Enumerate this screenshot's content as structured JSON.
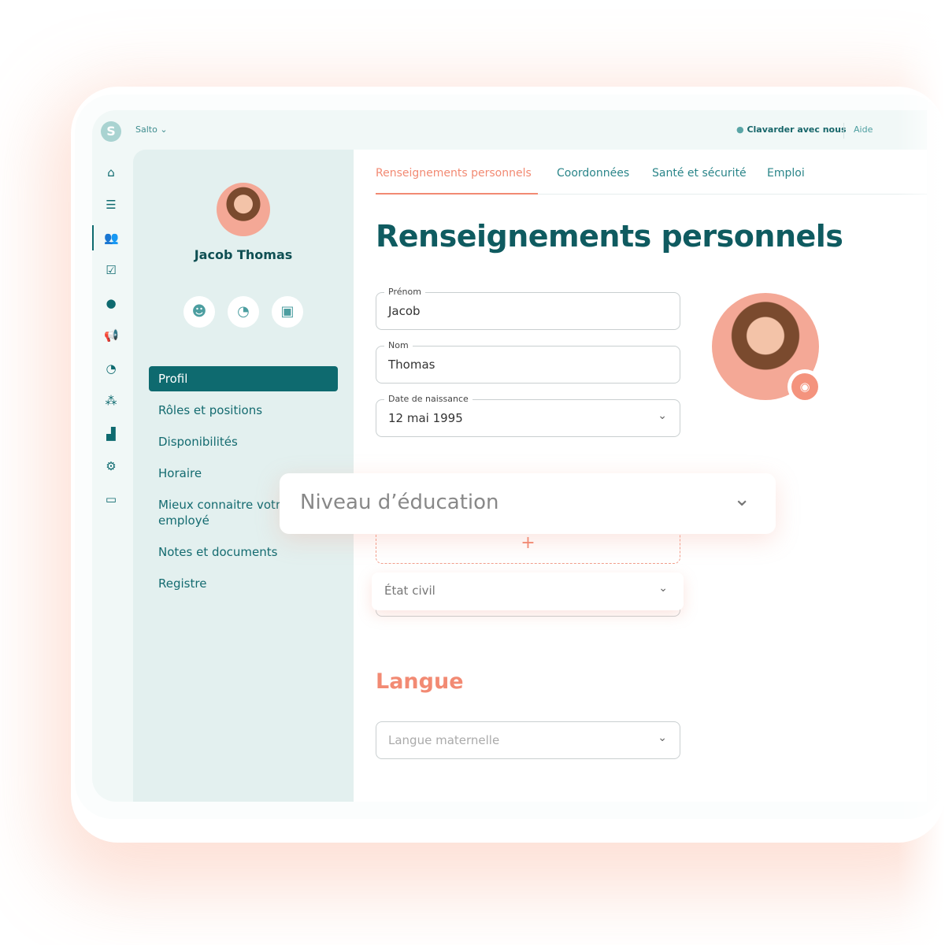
{
  "topbar": {
    "logo": "S",
    "org": "Salto",
    "chat": "Clavarder avec nous",
    "help": "Aide"
  },
  "rail": [
    "home-icon",
    "timeline-icon",
    "people-icon",
    "tasks-icon",
    "chat-icon",
    "megaphone-icon",
    "clock-icon",
    "org-icon",
    "chart-icon",
    "gear-icon",
    "card-icon"
  ],
  "profile": {
    "name": "Jacob Thomas"
  },
  "nav": [
    "Profil",
    "Rôles et positions",
    "Disponibilités",
    "Horaire",
    "Mieux connaitre votr",
    "employé",
    "Notes et documents",
    "Registre"
  ],
  "tabs": [
    "Renseignements personnels",
    "Coordonnées",
    "Santé et sécurité",
    "Emploi"
  ],
  "heading": "Renseignements personnels",
  "fields": {
    "prenom": {
      "label": "Prénom",
      "value": "Jacob"
    },
    "nom": {
      "label": "Nom",
      "value": "Thomas"
    },
    "dob": {
      "label": "Date de naissance",
      "value": "12 mai 1995"
    }
  },
  "education": "Niveau d’éducation",
  "civil": "État civil",
  "langue": {
    "heading": "Langue",
    "placeholder": "Langue maternelle"
  },
  "colors": {
    "teal": "#0e6a6f",
    "coral": "#f28a73"
  }
}
